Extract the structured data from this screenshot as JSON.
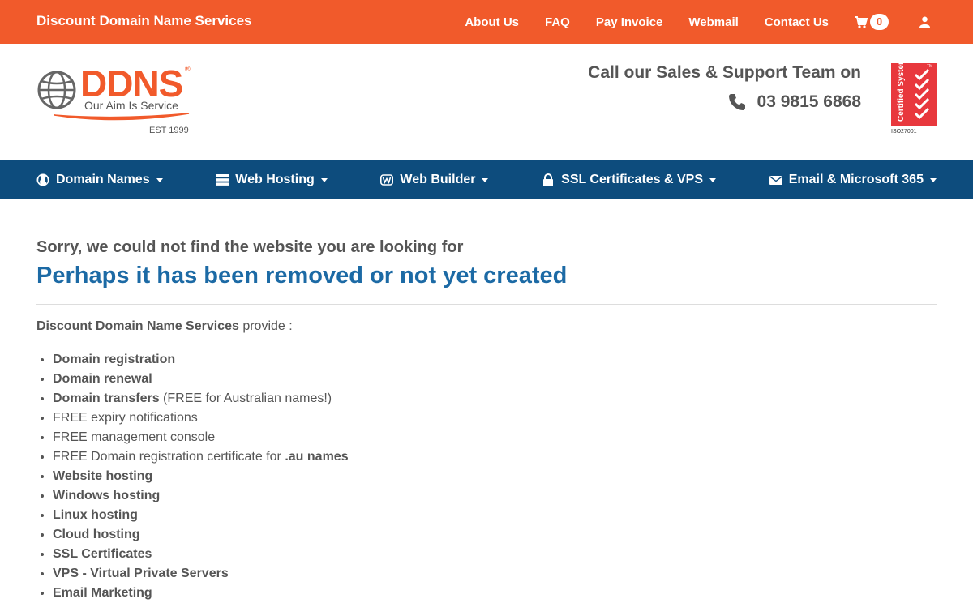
{
  "topbar": {
    "brand": "Discount Domain Name Services",
    "links": [
      "About Us",
      "FAQ",
      "Pay Invoice",
      "Webmail",
      "Contact Us"
    ],
    "cart_count": "0",
    "cart_icon": "shopping-cart-icon",
    "user_icon": "user-icon"
  },
  "header": {
    "logo_text": "DDNS",
    "logo_reg": "®",
    "logo_tagline": "Our Aim Is Service",
    "logo_est": "EST 1999",
    "call_label": "Call our Sales & Support Team on",
    "phone": "03 9815 6868",
    "cert_text": "Certified System",
    "cert_code": "ISO27001",
    "cert_tm": "TM"
  },
  "mainnav": {
    "items": [
      {
        "label": "Domain Names",
        "icon": "globe-icon"
      },
      {
        "label": "Web Hosting",
        "icon": "server-icon"
      },
      {
        "label": "Web Builder",
        "icon": "web-builder-icon"
      },
      {
        "label": "SSL Certificates & VPS",
        "icon": "lock-icon"
      },
      {
        "label": "Email & Microsoft 365",
        "icon": "envelope-icon"
      }
    ]
  },
  "content": {
    "sorry": "Sorry, we could not find the website you are looking for",
    "perhaps": "Perhaps it has been removed or not yet created",
    "intro_bold": "Discount Domain Name Services",
    "intro_rest": " provide :",
    "services": [
      {
        "bold": "Domain registration",
        "rest": ""
      },
      {
        "bold": "Domain renewal",
        "rest": ""
      },
      {
        "bold": "Domain transfers",
        "rest": " (FREE for Australian names!)"
      },
      {
        "bold": "",
        "rest": "FREE expiry notifications"
      },
      {
        "bold": "",
        "rest": "FREE management console"
      },
      {
        "bold": ".au names",
        "rest": "FREE Domain registration certificate for ",
        "bold_last": true
      },
      {
        "bold": "Website hosting",
        "rest": ""
      },
      {
        "bold": "Windows hosting",
        "rest": ""
      },
      {
        "bold": "Linux hosting",
        "rest": ""
      },
      {
        "bold": "Cloud hosting",
        "rest": ""
      },
      {
        "bold": "SSL Certificates",
        "rest": ""
      },
      {
        "bold": "VPS - Virtual Private Servers",
        "rest": ""
      },
      {
        "bold": "Email Marketing",
        "rest": ""
      }
    ]
  },
  "colors": {
    "orange": "#f15a2b",
    "navy": "#0d4c7d",
    "heading_blue": "#1c6aa5",
    "text": "#555555"
  }
}
